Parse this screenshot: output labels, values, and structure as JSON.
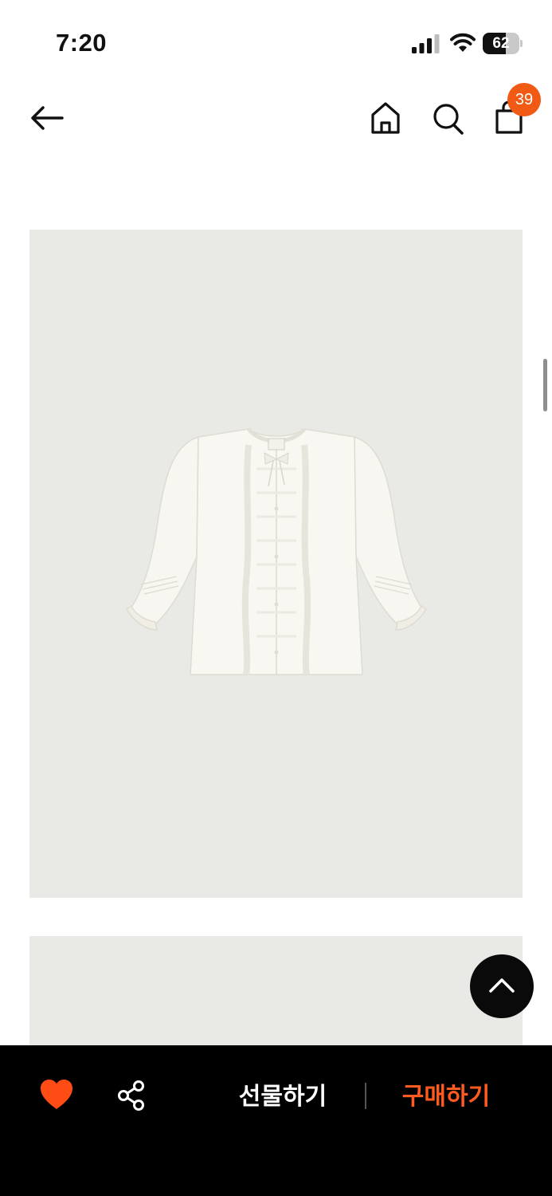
{
  "status_bar": {
    "time": "7:20",
    "battery": "62",
    "battery_level": 0.62
  },
  "nav": {
    "cart_count": "39"
  },
  "actions": {
    "gift_label": "선물하기",
    "buy_label": "구매하기"
  },
  "colors": {
    "accent": "#f05a14",
    "buy_text": "#ff5a1f",
    "bottom_bar": "#000000",
    "image_background": "#e9e9e6"
  },
  "icons": [
    "back-arrow-icon",
    "home-icon",
    "search-icon",
    "cart-icon",
    "chevron-up-icon",
    "heart-icon",
    "share-icon",
    "signal-icon",
    "wifi-icon",
    "battery-icon"
  ]
}
